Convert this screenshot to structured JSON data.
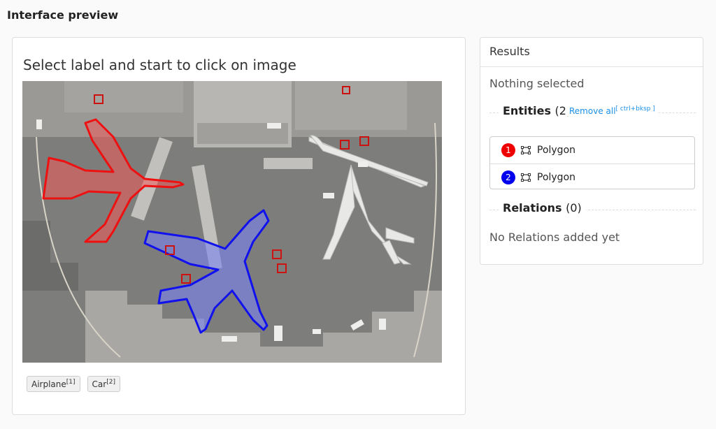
{
  "header": {
    "title": "Interface preview"
  },
  "canvas": {
    "prompt": "Select label and start to click on image",
    "labels": [
      {
        "name": "Airplane",
        "hotkey": "[1]"
      },
      {
        "name": "Car",
        "hotkey": "[2]"
      }
    ]
  },
  "results": {
    "title": "Results",
    "selection_status": "Nothing selected",
    "entities_title": "Entities",
    "entities_count": "(2)",
    "remove_all": "Remove all",
    "remove_all_hotkey": "[ ctrl+bksp ]",
    "entities": [
      {
        "index": "1",
        "label": "Polygon",
        "color": "#ee0000"
      },
      {
        "index": "2",
        "label": "Polygon",
        "color": "#0000ee"
      }
    ],
    "relations_title": "Relations",
    "relations_count": "(0)",
    "no_relations": "No Relations added yet"
  }
}
